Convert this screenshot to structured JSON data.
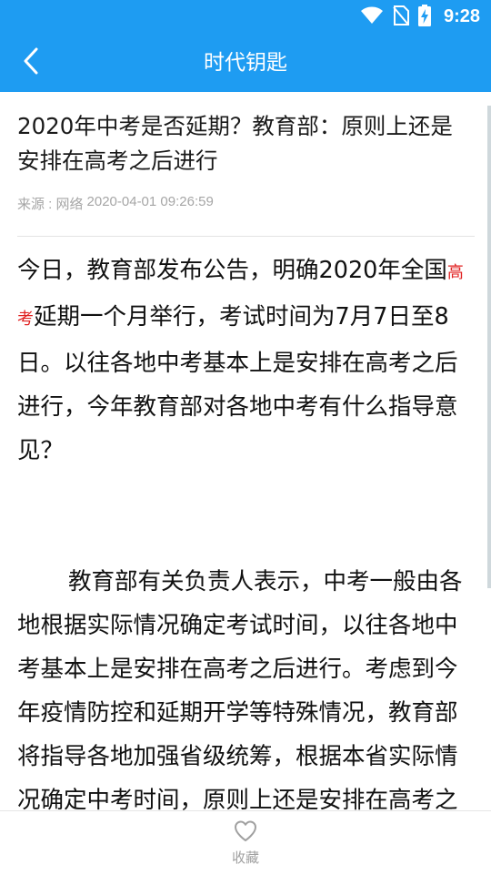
{
  "status_bar": {
    "time": "9:28",
    "icons": [
      "wifi-icon",
      "no-sim-icon",
      "battery-charging-icon"
    ]
  },
  "app_bar": {
    "back_icon": "chevron-left-icon",
    "title": "时代钥匙"
  },
  "article": {
    "title": "2020年中考是否延期？教育部：原则上还是安排在高考之后进行",
    "source_label": "来源 : 网络",
    "date": "2020-04-01 09:26:59",
    "p1_before": "今日，教育部发布公告，明确2020年全国",
    "p1_keyword": "高考",
    "p1_after": "延期一个月举行，考试时间为7月7日至8日。以往各地中考基本上是安排在高考之后进行，今年教育部对各地中考有什么指导意见？",
    "p2": "教育部有关负责人表示，中考一般由各地根据实际情况确定考试时间，以往各地中考基本上是安排在高考之后进行。考虑到今年疫情防控和延期开学等特殊情况，教育部将指导各地加强省级统筹，根据本省实际情况确定中考时间，原则上还是安排在高考之后进行。"
  },
  "bottom_bar": {
    "favorite_icon": "heart-outline-icon",
    "favorite_label": "收藏"
  },
  "colors": {
    "primary": "#1e9cf2",
    "keyword": "#e02020",
    "meta_text": "#a6a6a6"
  }
}
